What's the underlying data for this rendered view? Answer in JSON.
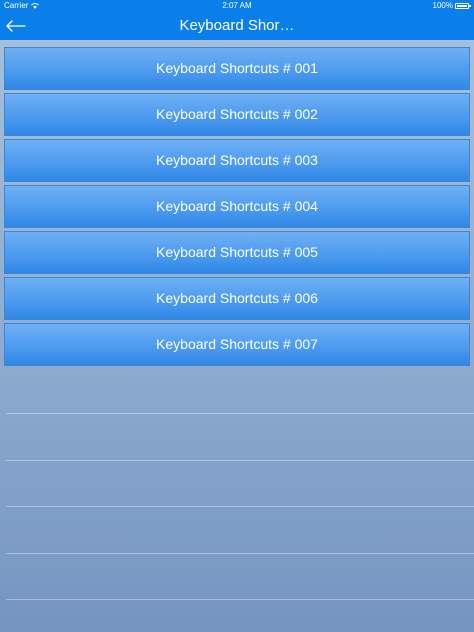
{
  "status_bar": {
    "carrier": "Carrier",
    "time": "2:07 AM",
    "battery": "100%"
  },
  "nav": {
    "title": "Keyboard Shor…",
    "back_icon": "back-arrow-icon"
  },
  "list": {
    "items": [
      {
        "label": "Keyboard Shortcuts # 001"
      },
      {
        "label": "Keyboard Shortcuts # 002"
      },
      {
        "label": "Keyboard Shortcuts # 003"
      },
      {
        "label": "Keyboard Shortcuts # 004"
      },
      {
        "label": "Keyboard Shortcuts # 005"
      },
      {
        "label": "Keyboard Shortcuts # 006"
      },
      {
        "label": "Keyboard Shortcuts # 007"
      }
    ]
  },
  "colors": {
    "nav_background": "#0b7fe9",
    "row_top": "#6fb0f4",
    "row_bottom": "#2f87e6",
    "background_top": "#a9c1dc",
    "background_bottom": "#7595c1"
  }
}
